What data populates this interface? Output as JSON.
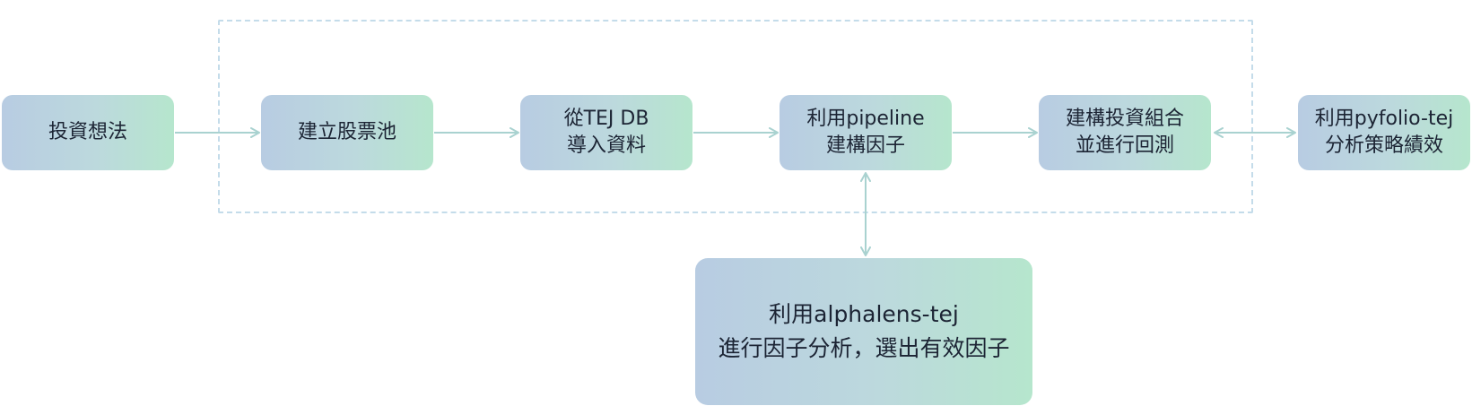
{
  "nodes": {
    "idea": {
      "lines": [
        "投資想法"
      ]
    },
    "stock_pool": {
      "lines": [
        "建立股票池"
      ]
    },
    "import_data": {
      "lines": [
        "從TEJ DB",
        "導入資料"
      ]
    },
    "pipeline": {
      "lines": [
        "利用pipeline",
        "建構因子"
      ]
    },
    "portfolio": {
      "lines": [
        "建構投資組合",
        "並進行回測"
      ]
    },
    "pyfolio": {
      "lines": [
        "利用pyfolio-tej",
        "分析策略績效"
      ]
    },
    "alphalens": {
      "lines": [
        "利用alphalens-tej",
        "進行因子分析，選出有效因子"
      ]
    }
  },
  "colors": {
    "node_gradient_start": "#b8cce2",
    "node_gradient_end": "#b6e6cd",
    "connector": "#a9d2d0",
    "frame_dash": "#c4dcea",
    "text": "#1c2434"
  }
}
